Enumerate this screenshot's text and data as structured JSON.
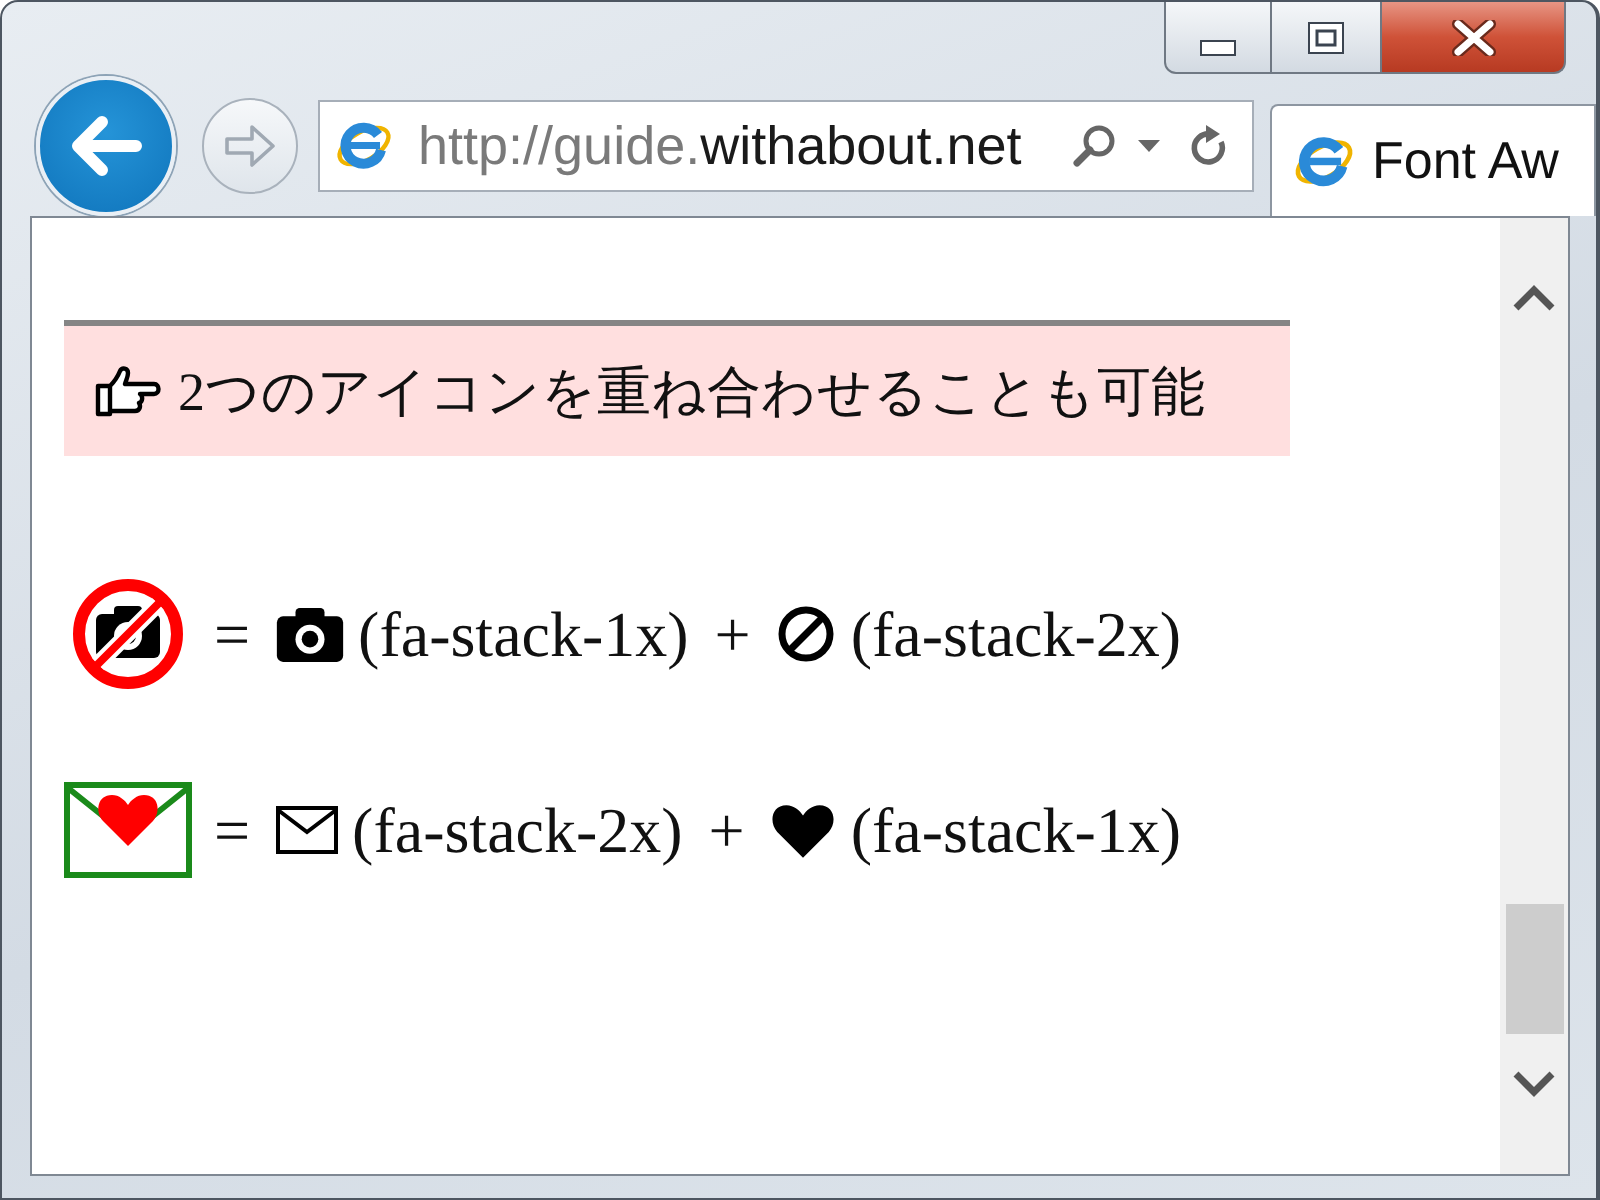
{
  "browser": {
    "address": {
      "prefix": "http://guide.",
      "domain": "withabout.net"
    },
    "tabs": [
      {
        "title": "Font Aw",
        "selected": true
      }
    ]
  },
  "page": {
    "heading": "2つのアイコンを重ね合わせることも可能",
    "examples": [
      {
        "kind": "camera-ban",
        "equals": "=",
        "plus": "+",
        "parts": [
          {
            "kind": "camera",
            "label": "(fa-stack-1x)"
          },
          {
            "kind": "ban",
            "label": "(fa-stack-2x)"
          }
        ]
      },
      {
        "kind": "envelope-heart",
        "equals": "=",
        "plus": "+",
        "parts": [
          {
            "kind": "envelope",
            "label": "(fa-stack-2x)"
          },
          {
            "kind": "heart",
            "label": "(fa-stack-1x)"
          }
        ]
      }
    ]
  }
}
